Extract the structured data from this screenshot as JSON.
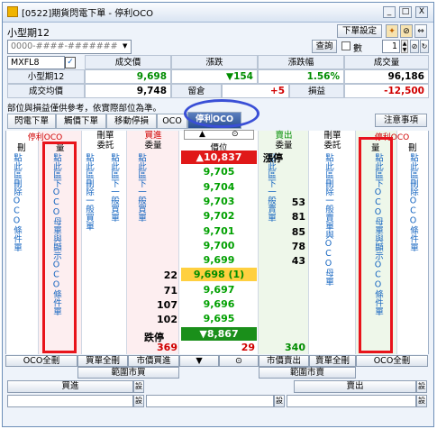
{
  "window": {
    "title": "[0522]期貨閃電下單 - 停利OCO",
    "controls": [
      "_",
      "□",
      "X"
    ]
  },
  "top_bar": {
    "product_name": "小型期12",
    "account_value": "0000-####-#######",
    "order_settings_label": "下單設定",
    "query_label": "查詢",
    "lots_label": "數",
    "lots_value": "1",
    "checkbox_symbol": "✓"
  },
  "quote_table": {
    "symbol_select": "MXFL8",
    "headers": [
      "成交價",
      "漲跌",
      "漲跌幅",
      "成交量"
    ],
    "product_label": "小型期12",
    "last_price": "9,698",
    "change": "▼154",
    "change_pct": "1.56%",
    "volume": "96,186",
    "avg_cost_label": "成交均價",
    "avg_cost": "9,748",
    "remain_label": "留倉",
    "remain": "+5",
    "pnl_label": "損益",
    "pnl": "-12,500"
  },
  "notice": "部位與損益僅供參考，依實際部位為準。",
  "tabs": [
    "閃電下單",
    "觸價下單",
    "移動停損",
    "OCO",
    "停利OCO"
  ],
  "active_tab": "停利OCO",
  "notes_button": "注意事項",
  "ladder": {
    "left_header_top": "停利OCO",
    "left_header": [
      "刪",
      "量"
    ],
    "buy_order_header": [
      "刪單",
      "委託"
    ],
    "buy_qty_header": [
      "買進",
      "委量"
    ],
    "price_header": "價位",
    "sell_qty_header": [
      "賣出",
      "委量"
    ],
    "sell_order_header": [
      "刪單",
      "委託"
    ],
    "right_header_top": "停利OCO",
    "right_header": [
      "量",
      "刪"
    ],
    "arrow_up": "▲",
    "target_icon": "⊙",
    "left_vertical_1": "點此區刪除OCO條件單",
    "left_vertical_2": "點此區下OCO母單與顯示OCO條件單",
    "mid_vertical_buy_del": "點此區刪除一般買單",
    "mid_vertical_buy": "點此區下一般買單",
    "mid_vertical_sell": "點此區下一般賣單",
    "mid_vertical_sell_del": "點此區刪除一般賣單與OCO母單",
    "right_vertical_1": "點此區下OCO母單與顯示OCO條件單",
    "right_vertical_2": "點此區刪除OCO條件單",
    "limit_up_label": "漲停",
    "limit_down_label": "跌停",
    "rows": [
      {
        "price": "▲10,837",
        "buy": "",
        "sell": "",
        "type": "up"
      },
      {
        "price": "9,705",
        "buy": "",
        "sell": ""
      },
      {
        "price": "9,704",
        "buy": "",
        "sell": ""
      },
      {
        "price": "9,703",
        "buy": "",
        "sell": "53"
      },
      {
        "price": "9,702",
        "buy": "",
        "sell": "81"
      },
      {
        "price": "9,701",
        "buy": "",
        "sell": "85"
      },
      {
        "price": "9,700",
        "buy": "",
        "sell": "78"
      },
      {
        "price": "9,699",
        "buy": "",
        "sell": "43"
      },
      {
        "price": "9,698 (1)",
        "buy": "22",
        "sell": "",
        "type": "last"
      },
      {
        "price": "9,697",
        "buy": "71",
        "sell": ""
      },
      {
        "price": "9,696",
        "buy": "107",
        "sell": ""
      },
      {
        "price": "9,695",
        "buy": "102",
        "sell": ""
      },
      {
        "price": "▼8,867",
        "buy": "",
        "sell": "",
        "type": "down"
      }
    ],
    "total_buy_orders": "369",
    "total_mid": "29",
    "total_sell_orders": "340"
  },
  "bottom_buttons": {
    "oco_delete_all_left": "OCO全刪",
    "buy_delete_all": "買單全刪",
    "market_buy": "市價買進",
    "down_arrow": "▼",
    "target": "⊙",
    "market_sell": "市價賣出",
    "sell_delete_all": "賣單全刪",
    "oco_delete_all_right": "OCO全刪",
    "range_market_buy": "範圍市買",
    "range_market_sell": "範圍市賣",
    "buy": "買進",
    "sell": "賣出",
    "set": "設"
  }
}
